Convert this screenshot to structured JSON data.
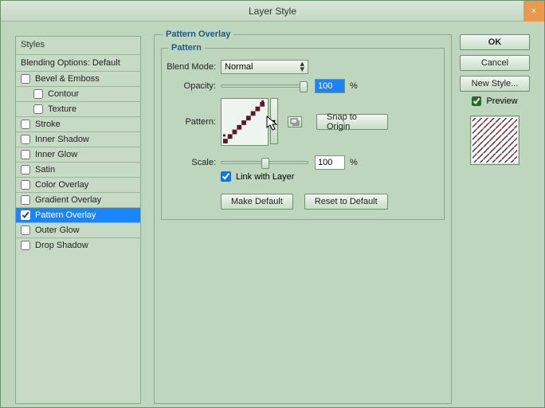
{
  "window": {
    "title": "Layer Style"
  },
  "styles_panel": {
    "header": "Styles",
    "blending": "Blending Options: Default",
    "items": [
      {
        "label": "Bevel & Emboss",
        "checked": false,
        "indent": false
      },
      {
        "label": "Contour",
        "checked": false,
        "indent": true
      },
      {
        "label": "Texture",
        "checked": false,
        "indent": true
      },
      {
        "label": "Stroke",
        "checked": false,
        "indent": false
      },
      {
        "label": "Inner Shadow",
        "checked": false,
        "indent": false
      },
      {
        "label": "Inner Glow",
        "checked": false,
        "indent": false
      },
      {
        "label": "Satin",
        "checked": false,
        "indent": false
      },
      {
        "label": "Color Overlay",
        "checked": false,
        "indent": false
      },
      {
        "label": "Gradient Overlay",
        "checked": false,
        "indent": false
      },
      {
        "label": "Pattern Overlay",
        "checked": true,
        "indent": false,
        "selected": true
      },
      {
        "label": "Outer Glow",
        "checked": false,
        "indent": false
      },
      {
        "label": "Drop Shadow",
        "checked": false,
        "indent": false
      }
    ]
  },
  "main": {
    "group_label": "Pattern Overlay",
    "sub_label": "Pattern",
    "blend_mode_label": "Blend Mode:",
    "blend_mode_value": "Normal",
    "opacity_label": "Opacity:",
    "opacity_value": "100",
    "opacity_unit": "%",
    "pattern_label": "Pattern:",
    "snap_label": "Snap to Origin",
    "scale_label": "Scale:",
    "scale_value": "100",
    "scale_unit": "%",
    "link_label": "Link with Layer",
    "link_checked": true,
    "make_default": "Make Default",
    "reset_default": "Reset to Default"
  },
  "right": {
    "ok": "OK",
    "cancel": "Cancel",
    "new_style": "New Style...",
    "preview_label": "Preview",
    "preview_checked": true
  },
  "colors": {
    "pattern_dark": "#5a1a2a"
  }
}
